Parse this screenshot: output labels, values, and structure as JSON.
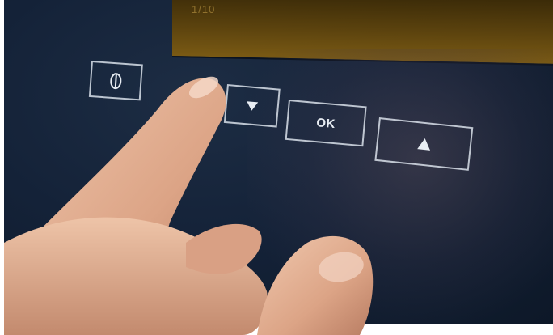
{
  "display": {
    "text": "1/10"
  },
  "controls": {
    "power": {
      "icon": "power-icon"
    },
    "down": {
      "icon": "triangle-down-icon",
      "glyph": "▼"
    },
    "ok": {
      "label": "OK"
    },
    "up": {
      "icon": "triangle-up-icon",
      "glyph": "▲"
    }
  },
  "colors": {
    "panel": "#142238",
    "display": "#5c430e",
    "button_outline": "#e1e8f0",
    "skin": "#e3b39a"
  }
}
